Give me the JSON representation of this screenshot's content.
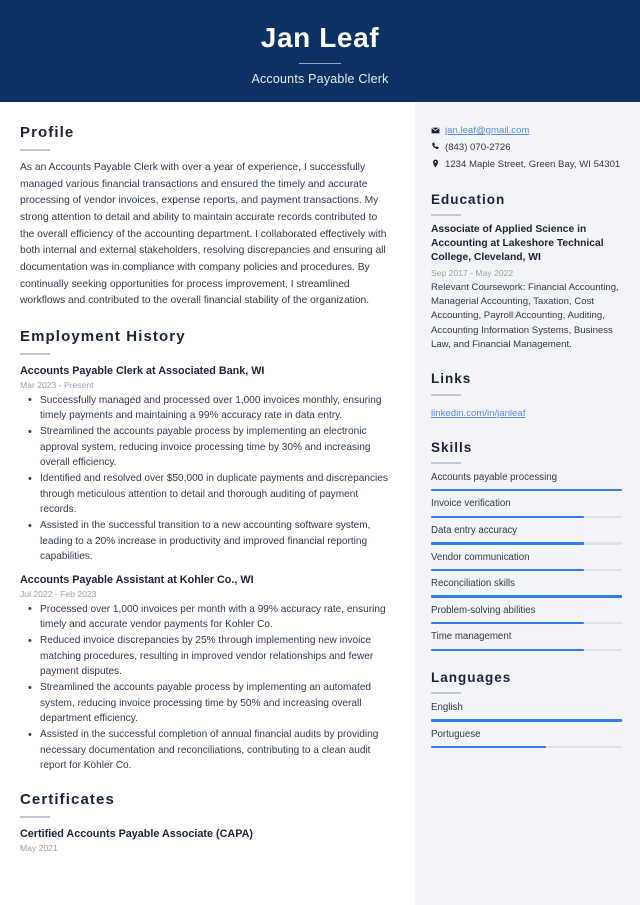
{
  "header": {
    "name": "Jan Leaf",
    "job_title": "Accounts Payable Clerk",
    "bg_color": "#0b3262"
  },
  "accent_color": "#2f7bf0",
  "link_color": "#5a8fd8",
  "main": {
    "profile": {
      "heading": "Profile",
      "text": "As an Accounts Payable Clerk with over a year of experience, I successfully managed various financial transactions and ensured the timely and accurate processing of vendor invoices, expense reports, and payment transactions. My strong attention to detail and ability to maintain accurate records contributed to the overall efficiency of the accounting department. I collaborated effectively with both internal and external stakeholders, resolving discrepancies and ensuring all documentation was in compliance with company policies and procedures. By continually seeking opportunities for process improvement, I streamlined workflows and contributed to the overall financial stability of the organization."
    },
    "employment": {
      "heading": "Employment History",
      "jobs": [
        {
          "title": "Accounts Payable Clerk at Associated Bank, WI",
          "date": "Mar 2023 - Present",
          "bullets": [
            "Successfully managed and processed over 1,000 invoices monthly, ensuring timely payments and maintaining a 99% accuracy rate in data entry.",
            "Streamlined the accounts payable process by implementing an electronic approval system, reducing invoice processing time by 30% and increasing overall efficiency.",
            "Identified and resolved over $50,000 in duplicate payments and discrepancies through meticulous attention to detail and thorough auditing of payment records.",
            "Assisted in the successful transition to a new accounting software system, leading to a 20% increase in productivity and improved financial reporting capabilities."
          ]
        },
        {
          "title": "Accounts Payable Assistant at Kohler Co., WI",
          "date": "Jul 2022 - Feb 2023",
          "bullets": [
            "Processed over 1,000 invoices per month with a 99% accuracy rate, ensuring timely and accurate vendor payments for Kohler Co.",
            "Reduced invoice discrepancies by 25% through implementing new invoice matching procedures, resulting in improved vendor relationships and fewer payment disputes.",
            "Streamlined the accounts payable process by implementing an automated system, reducing invoice processing time by 50% and increasing overall department efficiency.",
            "Assisted in the successful completion of annual financial audits by providing necessary documentation and reconciliations, contributing to a clean audit report for Kohler Co."
          ]
        }
      ]
    },
    "certificates": {
      "heading": "Certificates",
      "items": [
        {
          "title": "Certified Accounts Payable Associate (CAPA)",
          "date": "May 2021"
        }
      ]
    }
  },
  "sidebar": {
    "contact": [
      {
        "icon": "envelope-icon",
        "text": "jan.leaf@gmail.com",
        "is_link": true
      },
      {
        "icon": "phone-icon",
        "text": "(843) 070-2726",
        "is_link": false
      },
      {
        "icon": "location-pin-icon",
        "text": "1234 Maple Street, Green Bay, WI 54301",
        "is_link": false
      }
    ],
    "education": {
      "heading": "Education",
      "items": [
        {
          "degree": "Associate of Applied Science in Accounting at Lakeshore Technical College, Cleveland, WI",
          "date": "Sep 2017 - May 2022",
          "description": "Relevant Coursework: Financial Accounting, Managerial Accounting, Taxation, Cost Accounting, Payroll Accounting, Auditing, Accounting Information Systems, Business Law, and Financial Management."
        }
      ]
    },
    "links": {
      "heading": "Links",
      "items": [
        {
          "label": "linkedin.com/in/janleaf"
        }
      ]
    },
    "skills": {
      "heading": "Skills",
      "items": [
        {
          "label": "Accounts payable processing",
          "level": 100
        },
        {
          "label": "Invoice verification",
          "level": 80
        },
        {
          "label": "Data entry accuracy",
          "level": 80
        },
        {
          "label": "Vendor communication",
          "level": 80
        },
        {
          "label": "Reconciliation skills",
          "level": 100
        },
        {
          "label": "Problem-solving abilities",
          "level": 80
        },
        {
          "label": "Time management",
          "level": 80
        }
      ]
    },
    "languages": {
      "heading": "Languages",
      "items": [
        {
          "label": "English",
          "level": 100
        },
        {
          "label": "Portuguese",
          "level": 60
        }
      ]
    }
  }
}
